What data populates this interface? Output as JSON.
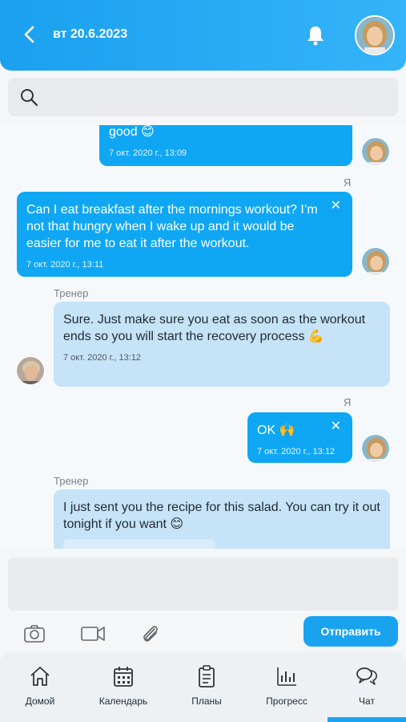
{
  "header": {
    "date": "вт 20.6.2023"
  },
  "search": {
    "placeholder": ""
  },
  "messages": [
    {
      "text": "good 😊",
      "time": "7 окт. 2020 г., 13:09"
    },
    {
      "sender": "Я",
      "text": "Can I eat breakfast after the mornings workout? I’m not that hungry when I wake up and it would be easier for me to eat it after the workout.",
      "time": "7 окт. 2020 г., 13:11",
      "close": "✕"
    },
    {
      "sender": "Тренер",
      "text": "Sure. Just make sure you eat as soon as the workout ends so you will start the recovery process 💪",
      "time": "7 окт. 2020 г., 13:12"
    },
    {
      "sender": "Я",
      "text": "OK 🙌",
      "time": "7 окт. 2020 г., 13:12",
      "close": "✕"
    },
    {
      "sender": "Тренер",
      "text": "I just sent you the recipe for this salad. You can try it out tonight if you want 😊"
    }
  ],
  "composer": {
    "send_label": "Отправить"
  },
  "nav": {
    "items": [
      {
        "label": "Домой",
        "icon": "home-icon"
      },
      {
        "label": "Календарь",
        "icon": "calendar-icon"
      },
      {
        "label": "Планы",
        "icon": "clipboard-icon"
      },
      {
        "label": "Прогресс",
        "icon": "bar-chart-icon"
      },
      {
        "label": "Чат",
        "icon": "chat-icon"
      }
    ],
    "active": "Чат"
  },
  "colors": {
    "accent": "#19a3ef",
    "my_bubble": "#0fa7f4",
    "coach_bubble": "#c6e3f7"
  }
}
